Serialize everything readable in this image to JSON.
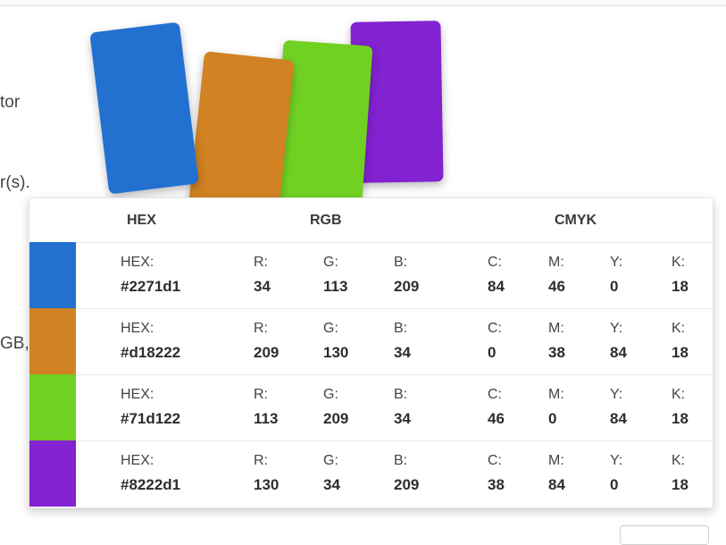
{
  "intro": {
    "lines": [
      "tor",
      "r(s).",
      "",
      "GB,"
    ]
  },
  "swatches": {
    "colors": [
      "#2271d1",
      "#d18222",
      "#71d122",
      "#8222d1"
    ]
  },
  "table": {
    "headers": {
      "hex": "HEX",
      "rgb": "RGB",
      "cmyk": "CMYK"
    },
    "rows": [
      {
        "color": "#2271d1",
        "hex_label": "HEX:",
        "hex": "#2271d1",
        "r_label": "R:",
        "r": "34",
        "g_label": "G:",
        "g": "113",
        "b_label": "B:",
        "b": "209",
        "c_label": "C:",
        "c": "84",
        "m_label": "M:",
        "m": "46",
        "y_label": "Y:",
        "y": "0",
        "k_label": "K:",
        "k": "18"
      },
      {
        "color": "#d18222",
        "hex_label": "HEX:",
        "hex": "#d18222",
        "r_label": "R:",
        "r": "209",
        "g_label": "G:",
        "g": "130",
        "b_label": "B:",
        "b": "34",
        "c_label": "C:",
        "c": "0",
        "m_label": "M:",
        "m": "38",
        "y_label": "Y:",
        "y": "84",
        "k_label": "K:",
        "k": "18"
      },
      {
        "color": "#71d122",
        "hex_label": "HEX:",
        "hex": "#71d122",
        "r_label": "R:",
        "r": "113",
        "g_label": "G:",
        "g": "209",
        "b_label": "B:",
        "b": "34",
        "c_label": "C:",
        "c": "46",
        "m_label": "M:",
        "m": "0",
        "y_label": "Y:",
        "y": "84",
        "k_label": "K:",
        "k": "18"
      },
      {
        "color": "#8222d1",
        "hex_label": "HEX:",
        "hex": "#8222d1",
        "r_label": "R:",
        "r": "130",
        "g_label": "G:",
        "g": "34",
        "b_label": "B:",
        "b": "209",
        "c_label": "C:",
        "c": "38",
        "m_label": "M:",
        "m": "84",
        "y_label": "Y:",
        "y": "0",
        "k_label": "K:",
        "k": "18"
      }
    ]
  }
}
